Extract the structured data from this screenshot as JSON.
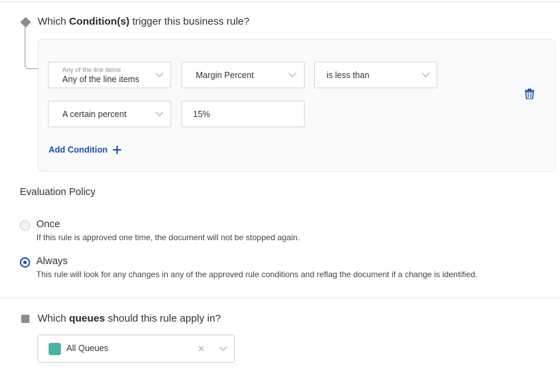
{
  "conditions_section": {
    "heading_pre": "Which ",
    "heading_bold": "Condition(s)",
    "heading_post": " trigger this business rule?",
    "rows": [
      {
        "scope": {
          "label": "Any of the line items",
          "value": "Any of the line items"
        },
        "field": "Margin Percent",
        "operator": "is less than"
      },
      {
        "compare_type": "A certain percent",
        "amount": "15%"
      }
    ],
    "delete_icon": "trash-icon",
    "add_condition_label": "Add Condition"
  },
  "evaluation_policy": {
    "label": "Evaluation Policy",
    "options": [
      {
        "title": "Once",
        "description": "If this rule is approved one time, the document will not be stopped again.",
        "selected": false
      },
      {
        "title": "Always",
        "description": "This rule will look for any changes in any of the approved rule conditions and reflag the document if a change is identified.",
        "selected": true
      }
    ]
  },
  "queues_section": {
    "heading_pre": "Which ",
    "heading_bold": "queues",
    "heading_post": " should this rule apply in?",
    "selected_queue": "All Queues",
    "queue_color": "#4ab3a4",
    "clear_glyph": "×"
  },
  "colors": {
    "accent": "#1f4fa8",
    "panel_bg": "#f9fafb",
    "step_marker": "#8c8c8c"
  }
}
